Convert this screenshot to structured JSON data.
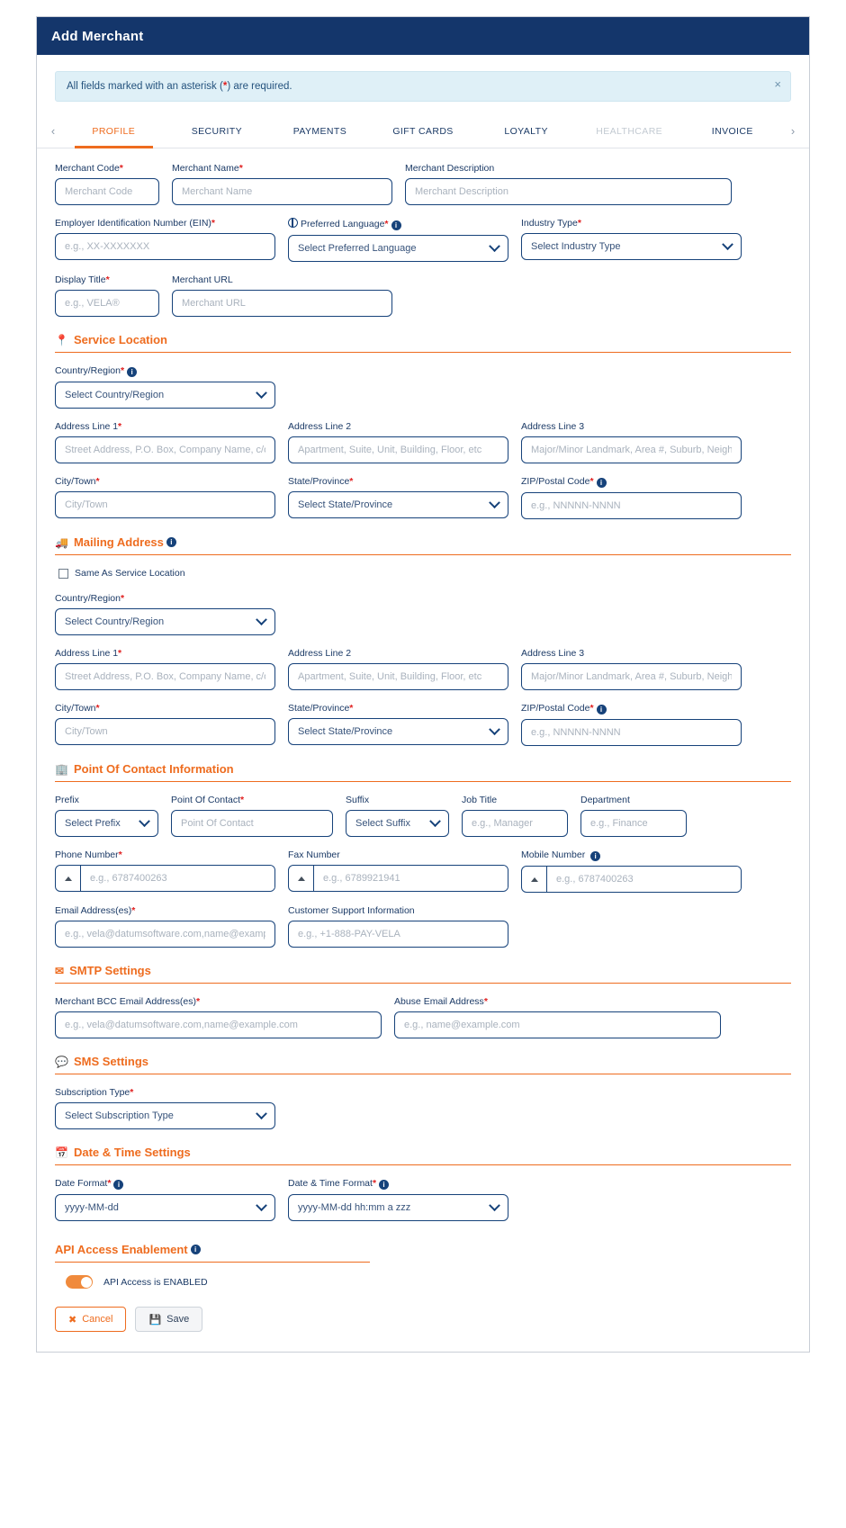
{
  "window": {
    "title": "Add Merchant"
  },
  "alert": {
    "prefix": "All fields marked with an asterisk (",
    "asterisk": "*",
    "suffix": ") are required.",
    "close": "×"
  },
  "tabs": {
    "prev": "‹",
    "next": "›",
    "items": [
      {
        "label": "PROFILE",
        "state": "active"
      },
      {
        "label": "SECURITY",
        "state": "normal"
      },
      {
        "label": "PAYMENTS",
        "state": "normal"
      },
      {
        "label": "GIFT CARDS",
        "state": "normal"
      },
      {
        "label": "LOYALTY",
        "state": "normal"
      },
      {
        "label": "HEALTHCARE",
        "state": "disabled"
      },
      {
        "label": "INVOICE",
        "state": "normal"
      }
    ]
  },
  "colors": {
    "header_bg": "#14366b",
    "accent": "#ee6c1f",
    "required": "#e02020",
    "field_border": "#16427a",
    "alert_bg": "#dff0f7"
  },
  "profile": {
    "merchant_code": {
      "label": "Merchant Code",
      "required": true,
      "placeholder": "Merchant Code"
    },
    "merchant_name": {
      "label": "Merchant Name",
      "required": true,
      "placeholder": "Merchant Name"
    },
    "merchant_description": {
      "label": "Merchant Description",
      "required": false,
      "placeholder": "Merchant Description"
    },
    "ein": {
      "label": "Employer Identification Number (EIN)",
      "required": true,
      "placeholder": "e.g., XX-XXXXXXX"
    },
    "preferred_language": {
      "label": "Preferred Language",
      "required": true,
      "value": "Select Preferred Language"
    },
    "industry_type": {
      "label": "Industry Type",
      "required": true,
      "value": "Select Industry Type"
    },
    "display_title": {
      "label": "Display Title",
      "required": true,
      "placeholder": "e.g., VELA®"
    },
    "merchant_url": {
      "label": "Merchant URL",
      "required": false,
      "placeholder": "Merchant URL"
    }
  },
  "service_location": {
    "heading": "Service Location",
    "icon": "map-pin-icon",
    "country": {
      "label": "Country/Region",
      "required": true,
      "value": "Select Country/Region"
    },
    "address1": {
      "label": "Address Line 1",
      "required": true,
      "placeholder": "Street Address, P.O. Box, Company Name, c/o"
    },
    "address2": {
      "label": "Address Line 2",
      "required": false,
      "placeholder": "Apartment, Suite, Unit, Building, Floor, etc"
    },
    "address3": {
      "label": "Address Line 3",
      "required": false,
      "placeholder": "Major/Minor Landmark, Area #, Suburb, Neighborhood"
    },
    "city": {
      "label": "City/Town",
      "required": true,
      "placeholder": "City/Town"
    },
    "state": {
      "label": "State/Province",
      "required": true,
      "value": "Select State/Province"
    },
    "zip": {
      "label": "ZIP/Postal Code",
      "required": true,
      "placeholder": "e.g., NNNNN-NNNN"
    }
  },
  "mailing_address": {
    "heading": "Mailing Address",
    "icon": "truck-icon",
    "same_as_service": "Same As Service Location",
    "country": {
      "label": "Country/Region",
      "required": true,
      "value": "Select Country/Region"
    },
    "address1": {
      "label": "Address Line 1",
      "required": true,
      "placeholder": "Street Address, P.O. Box, Company Name, c/o"
    },
    "address2": {
      "label": "Address Line 2",
      "required": false,
      "placeholder": "Apartment, Suite, Unit, Building, Floor, etc"
    },
    "address3": {
      "label": "Address Line 3",
      "required": false,
      "placeholder": "Major/Minor Landmark, Area #, Suburb, Neighborhood"
    },
    "city": {
      "label": "City/Town",
      "required": true,
      "placeholder": "City/Town"
    },
    "state": {
      "label": "State/Province",
      "required": true,
      "value": "Select State/Province"
    },
    "zip": {
      "label": "ZIP/Postal Code",
      "required": true,
      "placeholder": "e.g., NNNNN-NNNN"
    }
  },
  "point_of_contact": {
    "heading": "Point Of Contact Information",
    "icon": "building-icon",
    "prefix": {
      "label": "Prefix",
      "required": false,
      "value": "Select Prefix"
    },
    "contact": {
      "label": "Point Of Contact",
      "required": true,
      "placeholder": "Point Of Contact"
    },
    "suffix": {
      "label": "Suffix",
      "required": false,
      "value": "Select Suffix"
    },
    "job_title": {
      "label": "Job Title",
      "required": false,
      "placeholder": "e.g., Manager"
    },
    "department": {
      "label": "Department",
      "required": false,
      "placeholder": "e.g., Finance"
    },
    "phone": {
      "label": "Phone Number",
      "required": true,
      "placeholder": "e.g., 6787400263"
    },
    "fax": {
      "label": "Fax Number",
      "required": false,
      "placeholder": "e.g., 6789921941"
    },
    "mobile": {
      "label": "Mobile Number",
      "required": false,
      "placeholder": "e.g., 6787400263"
    },
    "email": {
      "label": "Email Address(es)",
      "required": true,
      "placeholder": "e.g., vela@datumsoftware.com,name@example.com"
    },
    "support": {
      "label": "Customer Support Information",
      "required": false,
      "placeholder": "e.g., +1-888-PAY-VELA"
    }
  },
  "smtp_settings": {
    "heading": "SMTP Settings",
    "icon": "envelope-icon",
    "bcc": {
      "label": "Merchant BCC Email Address(es)",
      "required": true,
      "placeholder": "e.g., vela@datumsoftware.com,name@example.com"
    },
    "abuse": {
      "label": "Abuse Email Address",
      "required": true,
      "placeholder": "e.g., name@example.com"
    }
  },
  "sms_settings": {
    "heading": "SMS Settings",
    "icon": "sms-bubble-icon",
    "subscription_type": {
      "label": "Subscription Type",
      "required": true,
      "value": "Select Subscription Type"
    }
  },
  "datetime_settings": {
    "heading": "Date & Time Settings",
    "icon": "calendar-icon",
    "date_format": {
      "label": "Date Format",
      "required": true,
      "value": "yyyy-MM-dd"
    },
    "datetime_format": {
      "label": "Date & Time Format",
      "required": true,
      "value": "yyyy-MM-dd hh:mm a zzz"
    }
  },
  "api_access": {
    "heading": "API Access Enablement",
    "status_label": "API Access is ENABLED",
    "enabled": true
  },
  "footer": {
    "cancel": "Cancel",
    "save": "Save",
    "cancel_icon": "circle-x-icon",
    "save_icon": "floppy-disk-icon"
  }
}
